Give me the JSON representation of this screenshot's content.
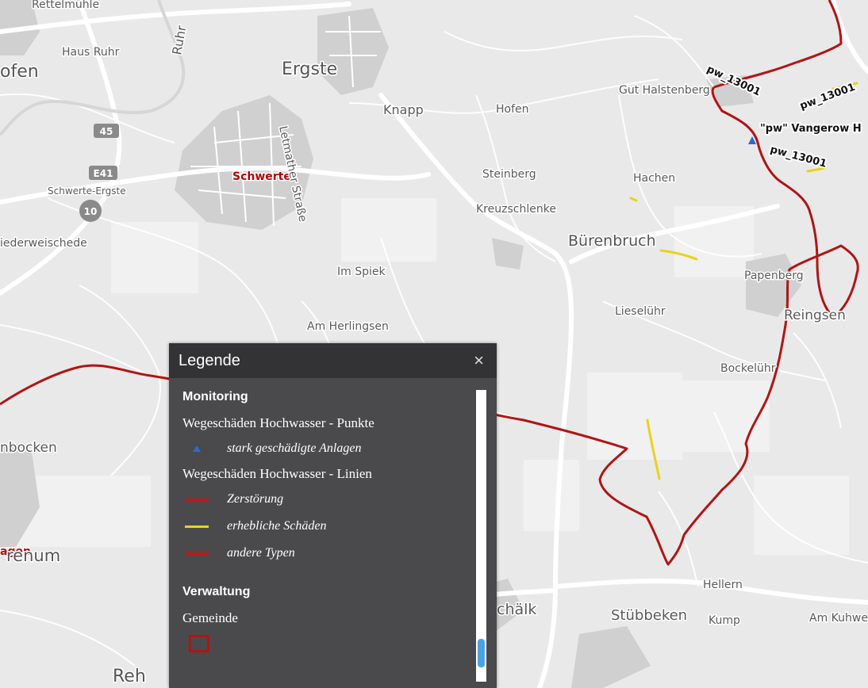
{
  "map": {
    "places": {
      "rettelmuehle": "Rettelmühle",
      "ofen": "ofen",
      "haus_ruhr": "Haus Ruhr",
      "ruhr": "Ruhr",
      "ergste": "Ergste",
      "knapp": "Knapp",
      "hofen": "Hofen",
      "gut_halstenberg": "Gut Halstenberg",
      "schwerte": "Schwerte",
      "schwerte_ergste": "Schwerte-Ergste",
      "letmather_strasse": "Letmather Straße",
      "steinberg": "Steinberg",
      "hachen": "Hachen",
      "kreuzschlenke": "Kreuzschlenke",
      "buerenbruch": "Bürenbruch",
      "iederweischede": "iederweischede",
      "im_spiek": "Im Spiek",
      "papenberg": "Papenberg",
      "lieseluehr": "Lieselühr",
      "reingsen": "Reingsen",
      "am_herlingsen": "Am Herlingsen",
      "bockeluehr": "Bockelühr",
      "nbocken": "nbocken",
      "agen": "agen",
      "renum": "renum",
      "hellern": "Hellern",
      "chaelk": "chälk",
      "stuebbeken": "Stübbeken",
      "kump": "Kump",
      "am_kuhweide": "Am Kuhwe",
      "reh": "Reh"
    },
    "shields": {
      "a45": "45",
      "e41": "E41",
      "exit10": "10"
    },
    "feature_labels": {
      "pw1": "pw_13001",
      "pw2": "pw_13001",
      "pw3": "pw_13001",
      "vangerow": "\"pw\" Vangerow H"
    },
    "colors": {
      "background": "#e9e9e9",
      "settlement": "#d2d2d2",
      "road": "#ffffff",
      "boundary": "#b01515",
      "damage_yellow": "#e8d21c",
      "point_blue": "#2a6ad6"
    }
  },
  "legend": {
    "title": "Legende",
    "close_symbol": "×",
    "groups": [
      {
        "title": "Monitoring",
        "layers": [
          {
            "title": "Wegeschäden Hochwasser - Punkte",
            "items": [
              {
                "label": "stark geschädigte Anlagen",
                "symbol": "triangle",
                "color": "#2a6ad6"
              }
            ]
          },
          {
            "title": "Wegeschäden Hochwasser - Linien",
            "items": [
              {
                "label": "Zerstörung",
                "symbol": "line",
                "color": "#c81414"
              },
              {
                "label": "erhebliche Schäden",
                "symbol": "line",
                "color": "#e8d21c"
              },
              {
                "label": "andere Typen",
                "symbol": "line",
                "color": "#c81414"
              }
            ]
          }
        ]
      },
      {
        "title": "Verwaltung",
        "layers": [
          {
            "title": "Gemeinde",
            "items": [
              {
                "label": "",
                "symbol": "square-outline",
                "color": "#b01515"
              }
            ]
          }
        ]
      }
    ]
  }
}
